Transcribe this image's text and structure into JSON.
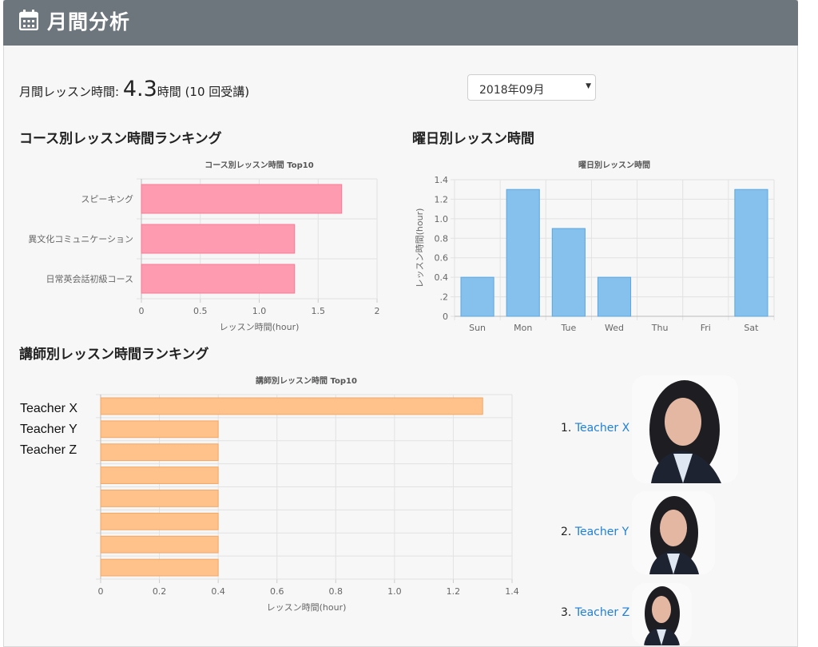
{
  "header": {
    "title": "月間分析",
    "icon": "calendar-icon"
  },
  "summary": {
    "label": "月間レッスン時間: ",
    "hours": "4.3",
    "unit": "時間",
    "count": " (10 回受講)"
  },
  "month_select": {
    "value": "2018年09月"
  },
  "sections": {
    "course": "コース別レッスン時間ランキング",
    "weekday": "曜日別レッスン時間",
    "teacher": "講師別レッスン時間ランキング"
  },
  "chart_data": [
    {
      "type": "bar",
      "orientation": "horizontal",
      "title": "コース別レッスン時間 Top10",
      "xlabel": "レッスン時間(hour)",
      "categories": [
        "スピーキング",
        "異文化コミュニケーション",
        "日常英会話初級コース"
      ],
      "values": [
        1.7,
        1.3,
        1.3
      ],
      "xlim": [
        0,
        2
      ],
      "ticks": [
        "0",
        "0.5",
        "1.0",
        "1.5",
        "2"
      ],
      "color": "#ff9bb0"
    },
    {
      "type": "bar",
      "title": "曜日別レッスン時間",
      "ylabel": "レッスン時間(hour)",
      "categories": [
        "Sun",
        "Mon",
        "Tue",
        "Wed",
        "Thu",
        "Fri",
        "Sat"
      ],
      "values": [
        0.4,
        1.3,
        0.9,
        0.4,
        0,
        0,
        1.3
      ],
      "ylim": [
        0,
        1.4
      ],
      "ticks": [
        "0",
        ".2",
        "0.4",
        "0.6",
        "0.8",
        "1.0",
        "1.2",
        "1.4"
      ],
      "color": "#86c0ed"
    },
    {
      "type": "bar",
      "orientation": "horizontal",
      "title": "講師別レッスン時間 Top10",
      "xlabel": "レッスン時間(hour)",
      "categories": [
        "Teacher X",
        "Teacher Y",
        "Teacher Z",
        "",
        "",
        "",
        "",
        ""
      ],
      "values": [
        1.3,
        0.4,
        0.4,
        0.4,
        0.4,
        0.4,
        0.4,
        0.4
      ],
      "xlim": [
        0,
        1.4
      ],
      "ticks": [
        "0",
        "0.2",
        "0.4",
        "0.6",
        "0.8",
        "1.0",
        "1.2",
        "1.4"
      ],
      "color": "#ffc28a"
    }
  ],
  "ranking": [
    {
      "rank": "1.",
      "name": "Teacher X"
    },
    {
      "rank": "2.",
      "name": "Teacher Y"
    },
    {
      "rank": "3.",
      "name": "Teacher Z"
    }
  ]
}
